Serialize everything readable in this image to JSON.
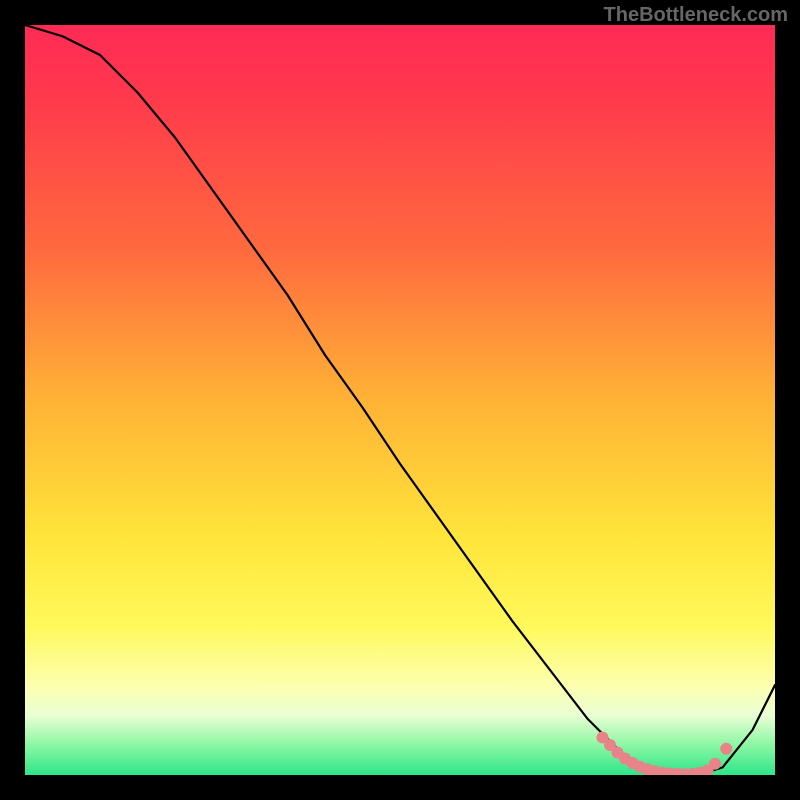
{
  "attribution": "TheBottleneck.com",
  "chart_data": {
    "type": "line",
    "title": "",
    "xlabel": "",
    "ylabel": "",
    "x": [
      0.0,
      0.05,
      0.1,
      0.15,
      0.2,
      0.25,
      0.3,
      0.35,
      0.4,
      0.45,
      0.5,
      0.55,
      0.6,
      0.65,
      0.7,
      0.75,
      0.8,
      0.82,
      0.85,
      0.88,
      0.9,
      0.93,
      0.97,
      1.0
    ],
    "y": [
      1.0,
      0.985,
      0.96,
      0.91,
      0.85,
      0.78,
      0.71,
      0.64,
      0.56,
      0.49,
      0.415,
      0.345,
      0.275,
      0.205,
      0.14,
      0.075,
      0.025,
      0.012,
      0.004,
      0.001,
      0.001,
      0.01,
      0.06,
      0.12
    ],
    "xlim": [
      0,
      1
    ],
    "ylim": [
      0,
      1
    ],
    "highlight_dots_x": [
      0.77,
      0.78,
      0.79,
      0.8,
      0.81,
      0.82,
      0.83,
      0.84,
      0.85,
      0.86,
      0.87,
      0.88,
      0.89,
      0.9,
      0.91,
      0.92,
      0.935
    ],
    "highlight_dots_y": [
      0.05,
      0.04,
      0.03,
      0.022,
      0.016,
      0.011,
      0.0075,
      0.005,
      0.003,
      0.002,
      0.0015,
      0.001,
      0.0015,
      0.003,
      0.006,
      0.015,
      0.035
    ],
    "dot_color": "#e9838a",
    "line_color": "#000000"
  }
}
